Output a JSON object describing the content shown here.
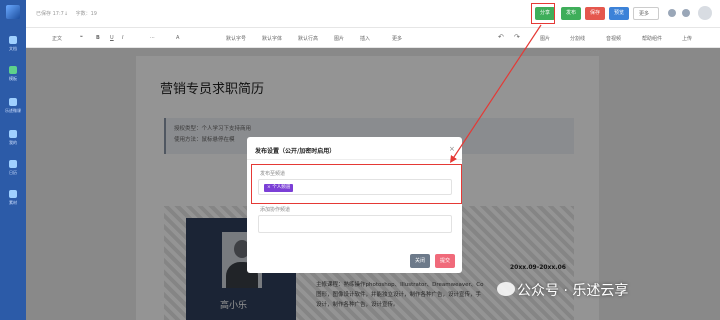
{
  "topbar": {
    "saved_label": "已保存 17:7↓",
    "word_count": "字数：19",
    "buttons": {
      "share": "分享",
      "publish": "发布",
      "save": "保存",
      "preview": "预览",
      "more": "更多"
    }
  },
  "sidebar": {
    "items": [
      {
        "label": "文档",
        "icon": "document-icon"
      },
      {
        "label": "模板",
        "icon": "template-icon"
      },
      {
        "label": "乐述微课",
        "icon": "course-icon"
      },
      {
        "label": "我的",
        "icon": "user-icon"
      },
      {
        "label": "日历",
        "icon": "calendar-icon"
      },
      {
        "label": "素材",
        "icon": "material-icon"
      }
    ]
  },
  "toolbar": {
    "style": "正文",
    "quote": "❝",
    "bold": "B",
    "underline": "U",
    "italic": "I",
    "more_text": "⋯",
    "font_color": "A",
    "font_size": "默认字号",
    "font_family": "默认字体",
    "line_height": "默认行高",
    "image": "图片",
    "insert": "插入",
    "more": "更多",
    "undo": "↶",
    "redo": "↷",
    "doc_images": "图片",
    "shapes": "分割线",
    "audio": "音视频",
    "page_edit": "帮助组件",
    "upload": "上传"
  },
  "document": {
    "title": "营销专员求职简历",
    "tip_lines": [
      "授权类型：个人学习下支持商用",
      "使用方法：鼠标悬停在模"
    ],
    "resume": {
      "name": "高小乐",
      "date_range": "20xx.09-20xx.06",
      "text_lines": [
        "主修课程：熟练操作photoshop、Illustrator、Dreamweaver、Co",
        "图形，图像设计软件，并能独立设计，制作各种广告，设计宣传，手",
        "设计，制作各种广告，设计宣传。"
      ]
    }
  },
  "modal": {
    "title": "发布设置（公开/加密时启用）",
    "close_icon": "×",
    "publish_channel_label": "发布至频道",
    "selected_channel": "× 个人频道",
    "add_channel_label": "添加协作频道",
    "buttons": {
      "close": "关闭",
      "submit": "提交"
    }
  },
  "watermark": {
    "text": "公众号 · 乐述云享"
  },
  "colors": {
    "sidebar": "#2c5ba8",
    "publish_green": "#3fae5a",
    "save_red": "#e5574d",
    "preview_blue": "#3c82d8",
    "highlight_red": "#e53935",
    "chip_purple": "#7b3fd6",
    "submit_pink": "#f06a7a"
  }
}
